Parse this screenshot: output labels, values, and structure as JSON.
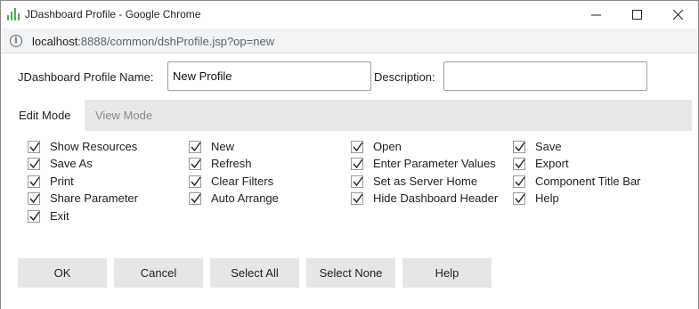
{
  "window": {
    "title": "JDashboard Profile - Google Chrome",
    "url_host": "localhost",
    "url_rest": ":8888/common/dshProfile.jsp?op=new"
  },
  "form": {
    "name_label": "JDashboard Profile Name:",
    "name_value": "New Profile",
    "description_label": "Description:",
    "description_value": ""
  },
  "tabs": [
    {
      "label": "Edit Mode",
      "active": true
    },
    {
      "label": "View Mode",
      "active": false
    }
  ],
  "options": {
    "col1": [
      {
        "label": "Show Resources",
        "checked": true
      },
      {
        "label": "Save As",
        "checked": true
      },
      {
        "label": "Print",
        "checked": true
      },
      {
        "label": "Share Parameter",
        "checked": true
      },
      {
        "label": "Exit",
        "checked": true
      }
    ],
    "col2": [
      {
        "label": "New",
        "checked": true
      },
      {
        "label": "Refresh",
        "checked": true
      },
      {
        "label": "Clear Filters",
        "checked": true
      },
      {
        "label": "Auto Arrange",
        "checked": true
      }
    ],
    "col3": [
      {
        "label": "Open",
        "checked": true
      },
      {
        "label": "Enter Parameter Values",
        "checked": true
      },
      {
        "label": "Set as Server Home",
        "checked": true
      },
      {
        "label": "Hide Dashboard Header",
        "checked": true
      }
    ],
    "col4": [
      {
        "label": "Save",
        "checked": true
      },
      {
        "label": "Export",
        "checked": true
      },
      {
        "label": "Component Title Bar",
        "checked": true
      },
      {
        "label": "Help",
        "checked": true
      }
    ]
  },
  "buttons": {
    "ok": "OK",
    "cancel": "Cancel",
    "select_all": "Select All",
    "select_none": "Select None",
    "help": "Help"
  },
  "icons": {
    "app": "jdashboard-app-icon",
    "info": "info-icon",
    "check": "checkmark-icon"
  },
  "colors": {
    "tab_bar": "#e8e8e8",
    "button_bg": "#e6e6e6",
    "app_icon": "#4caf50"
  }
}
